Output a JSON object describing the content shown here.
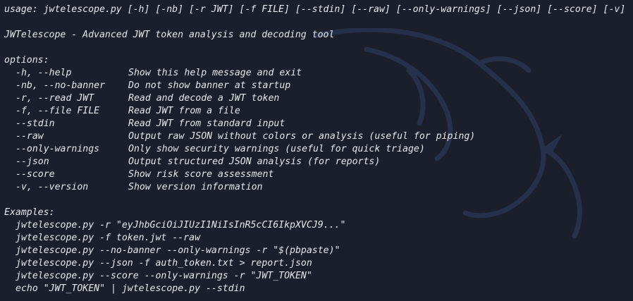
{
  "usage": "usage: jwtelescope.py [-h] [-nb] [-r JWT] [-f FILE] [--stdin] [--raw] [--only-warnings] [--json] [--score] [-v]",
  "description": "JWTelescope - Advanced JWT token analysis and decoding tool",
  "options_header": "options:",
  "options": [
    {
      "flag": "-h, --help",
      "desc": "Show this help message and exit"
    },
    {
      "flag": "-nb, --no-banner",
      "desc": "Do not show banner at startup"
    },
    {
      "flag": "-r, --read JWT",
      "desc": "Read and decode a JWT token"
    },
    {
      "flag": "-f, --file FILE",
      "desc": "Read JWT from a file"
    },
    {
      "flag": "--stdin",
      "desc": "Read JWT from standard input"
    },
    {
      "flag": "--raw",
      "desc": "Output raw JSON without colors or analysis (useful for piping)"
    },
    {
      "flag": "--only-warnings",
      "desc": "Only show security warnings (useful for quick triage)"
    },
    {
      "flag": "--json",
      "desc": "Output structured JSON analysis (for reports)"
    },
    {
      "flag": "--score",
      "desc": "Show risk score assessment"
    },
    {
      "flag": "-v, --version",
      "desc": "Show version information"
    }
  ],
  "examples_header": "Examples:",
  "examples": [
    "jwtelescope.py -r \"eyJhbGciOiJIUzI1NiIsInR5cCI6IkpXVCJ9...\"",
    "jwtelescope.py -f token.jwt --raw",
    "jwtelescope.py --no-banner --only-warnings -r \"$(pbpaste)\"",
    "jwtelescope.py --json -f auth_token.txt > report.json",
    "jwtelescope.py --score --only-warnings -r \"JWT_TOKEN\"",
    "echo \"JWT_TOKEN\" | jwtelescope.py --stdin"
  ],
  "colors": {
    "background": "#1b1e2b",
    "text": "#e6e8ee",
    "watermark": "#2a3552"
  },
  "icons": {
    "watermark": "kali-dragon-icon"
  }
}
